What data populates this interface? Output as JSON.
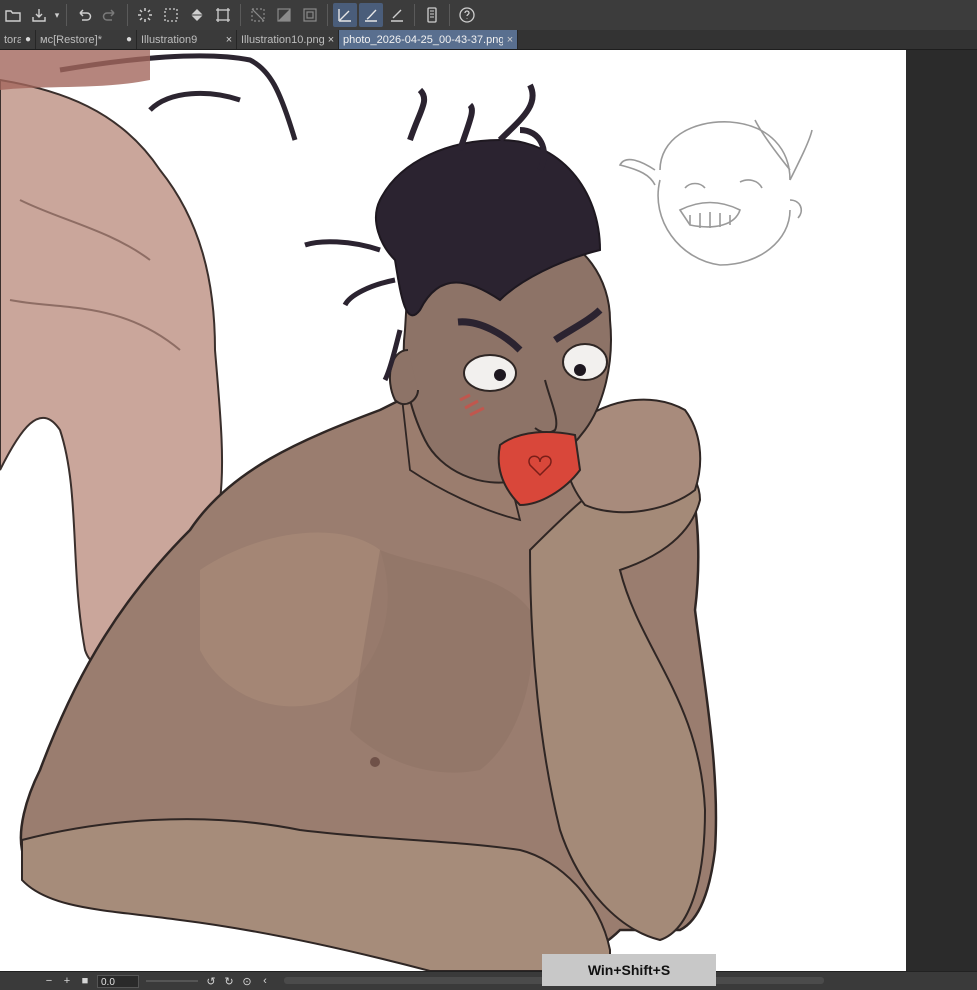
{
  "toolbar": {
    "icons": [
      "open-folder-icon",
      "save-icon",
      "undo-icon",
      "redo-icon",
      "loading-spinner-icon",
      "selection-icon",
      "fill-icon",
      "transform-icon",
      "deselect-icon",
      "invert-selection-icon",
      "crop-icon",
      "pen-tool-icon",
      "brush-tool-icon",
      "eraser-line-icon",
      "device-icon",
      "help-icon"
    ]
  },
  "tabs": [
    {
      "label": "tora",
      "state": "modified"
    },
    {
      "label": "мс[Restore]*",
      "state": "modified"
    },
    {
      "label": "Illustration9",
      "state": "closable"
    },
    {
      "label": "Illustration10.png",
      "state": "closable"
    },
    {
      "label": "photo_2026-04-25_00-43-37.png",
      "state": "active"
    }
  ],
  "tab_marks": {
    "dot": "●",
    "close": "×"
  },
  "status": {
    "zoom_minus": "−",
    "zoom_plus": "+",
    "stop": "■",
    "rotation_value": "0.0",
    "rotate_left": "↺",
    "rotate_right": "↻",
    "reset": "⊙",
    "collapse": "‹"
  },
  "overlay": {
    "shortcut_hint": "Win+Shift+S"
  },
  "colors": {
    "accent": "#596f8f",
    "canvas": "#ffffff",
    "workspace": "#2b2b2b"
  }
}
